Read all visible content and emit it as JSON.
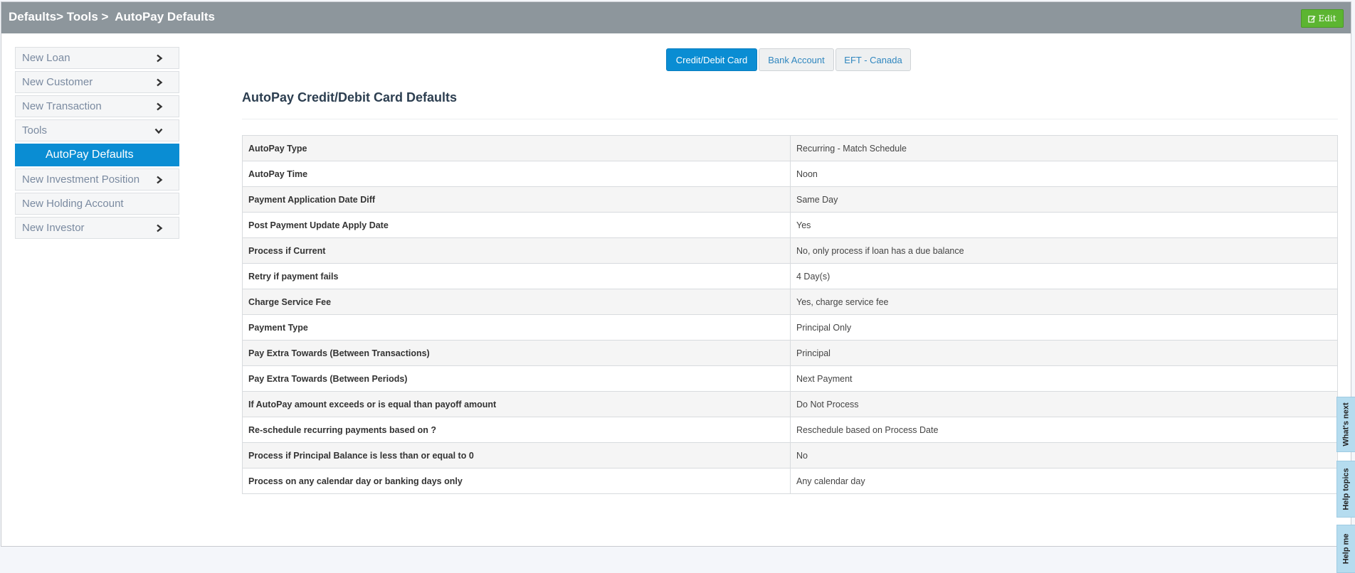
{
  "header": {
    "breadcrumb": "Defaults> Tools >  AutoPay Defaults",
    "edit_label": "Edit"
  },
  "sidebar": {
    "items": [
      {
        "label": "New Loan",
        "icon": "chevron-right-icon"
      },
      {
        "label": "New Customer",
        "icon": "chevron-right-icon"
      },
      {
        "label": "New Transaction",
        "icon": "chevron-right-icon"
      },
      {
        "label": "Tools",
        "icon": "chevron-down-icon"
      },
      {
        "label": "AutoPay Defaults"
      },
      {
        "label": "New Investment Position",
        "icon": "chevron-right-icon"
      },
      {
        "label": "New Holding Account"
      },
      {
        "label": "New Investor",
        "icon": "chevron-right-icon"
      }
    ]
  },
  "tabs": [
    {
      "label": "Credit/Debit Card",
      "active": true
    },
    {
      "label": "Bank Account",
      "active": false
    },
    {
      "label": "EFT - Canada",
      "active": false
    }
  ],
  "main": {
    "title": "AutoPay Credit/Debit Card Defaults",
    "rows": [
      {
        "key": "AutoPay Type",
        "value": "Recurring - Match Schedule"
      },
      {
        "key": "AutoPay Time",
        "value": "Noon"
      },
      {
        "key": "Payment Application Date Diff",
        "value": "Same Day"
      },
      {
        "key": "Post Payment Update Apply Date",
        "value": "Yes"
      },
      {
        "key": "Process if Current",
        "value": "No, only process if loan has a due balance"
      },
      {
        "key": "Retry if payment fails",
        "value": "4 Day(s)"
      },
      {
        "key": "Charge Service Fee",
        "value": "Yes, charge service fee"
      },
      {
        "key": "Payment Type",
        "value": "Principal Only"
      },
      {
        "key": "Pay Extra Towards (Between Transactions)",
        "value": "Principal"
      },
      {
        "key": "Pay Extra Towards (Between Periods)",
        "value": "Next Payment"
      },
      {
        "key": "If AutoPay amount exceeds or is equal than payoff amount",
        "value": "Do Not Process"
      },
      {
        "key": "Re-schedule recurring payments based on ?",
        "value": "Reschedule based on Process Date"
      },
      {
        "key": "Process if Principal Balance is less than or equal to 0",
        "value": "No"
      },
      {
        "key": "Process on any calendar day or banking days only",
        "value": "Any calendar day"
      }
    ]
  },
  "side_tabs": [
    "What's next",
    "Help topics",
    "Help me"
  ],
  "colors": {
    "topbar": "#8d969c",
    "accent": "#0a8dd3",
    "edit_button": "#5cb531",
    "side_tab": "#b5dcef"
  }
}
